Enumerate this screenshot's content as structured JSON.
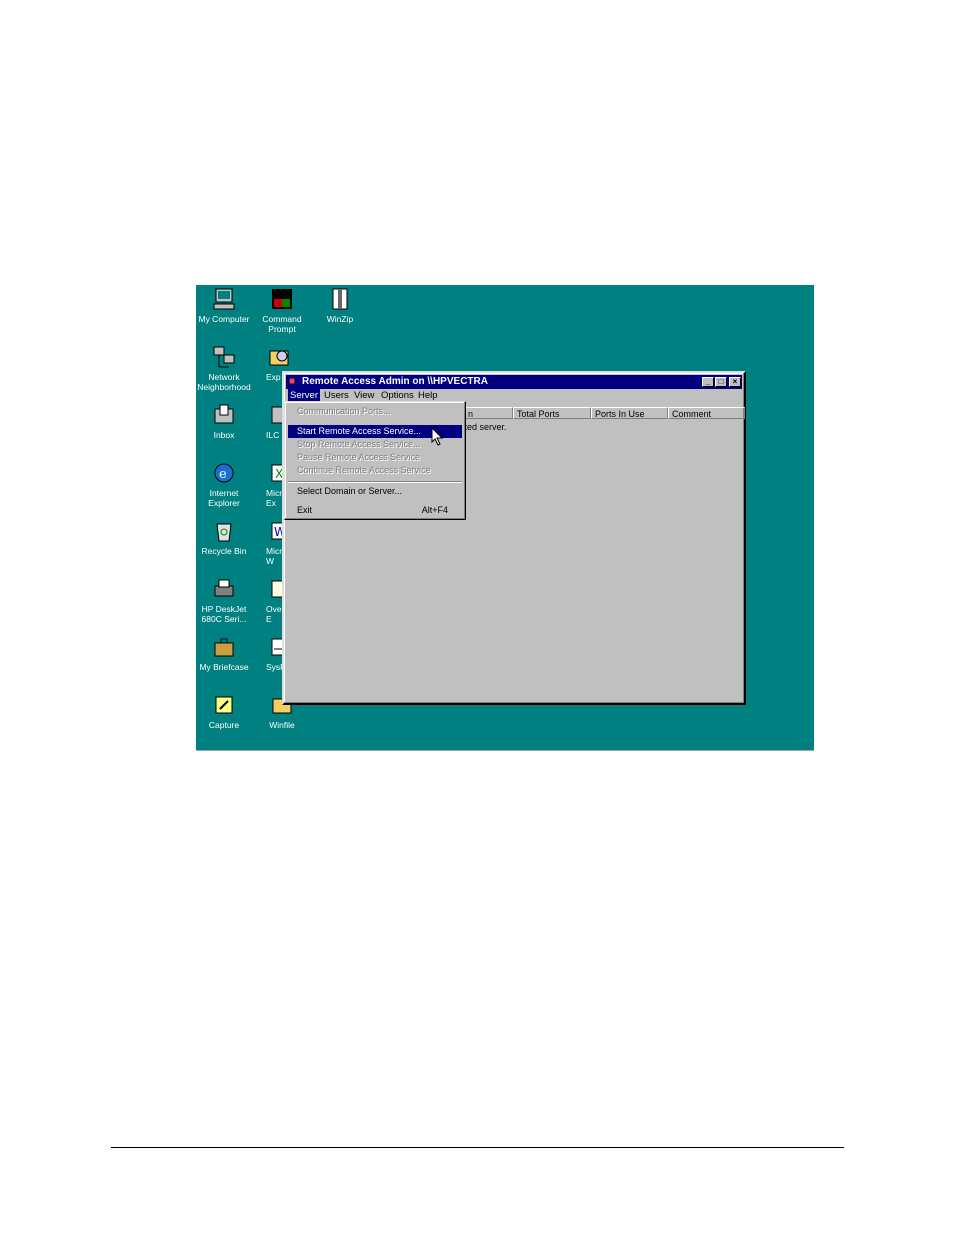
{
  "desktop_icons": [
    {
      "name": "my-computer-icon",
      "label": "My Computer"
    },
    {
      "name": "command-prompt-icon",
      "label": "Command\nPrompt"
    },
    {
      "name": "winzip-icon",
      "label": "WinZip"
    },
    {
      "name": "network-neighborhood-icon",
      "label": "Network\nNeighborhood"
    },
    {
      "name": "explorer-icon",
      "label": "Exp"
    },
    {
      "name": "inbox-icon",
      "label": "Inbox"
    },
    {
      "name": "ilc-icon",
      "label": "ILC"
    },
    {
      "name": "internet-explorer-icon",
      "label": "Internet\nExplorer"
    },
    {
      "name": "microsoft-excel-icon",
      "label": "Micr\nEx"
    },
    {
      "name": "recycle-bin-icon",
      "label": "Recycle Bin"
    },
    {
      "name": "microsoft-word-icon",
      "label": "Micr\nW"
    },
    {
      "name": "hp-deskjet-icon",
      "label": "HP DeskJet\n680C Seri..."
    },
    {
      "name": "overview-icon",
      "label": "Ove\nE"
    },
    {
      "name": "my-briefcase-icon",
      "label": "My Briefcase"
    },
    {
      "name": "sysreport-icon",
      "label": "SysRe"
    },
    {
      "name": "capture-icon",
      "label": "Capture"
    },
    {
      "name": "winfile-icon",
      "label": "Winfile"
    }
  ],
  "window": {
    "title": "Remote Access Admin on \\\\HPVECTRA",
    "menu": {
      "server": "Server",
      "users": "Users",
      "view": "View",
      "options": "Options",
      "help": "Help"
    },
    "columns": {
      "c0": "n",
      "c1": "Total Ports",
      "c2": "Ports In Use",
      "c3": "Comment"
    },
    "status_text": "cted server."
  },
  "server_menu": {
    "communication_ports": "Communication Ports...",
    "start_service": "Start Remote Access Service...",
    "stop_service": "Stop Remote Access Service...",
    "pause_service": "Pause Remote Access Service",
    "continue_service": "Continue Remote Access Service",
    "select_domain": "Select Domain or Server...",
    "exit": "Exit",
    "exit_shortcut": "Alt+F4"
  },
  "colors": {
    "desktop": "#008080",
    "titlebar": "#000080",
    "face": "#c0c0c0"
  }
}
